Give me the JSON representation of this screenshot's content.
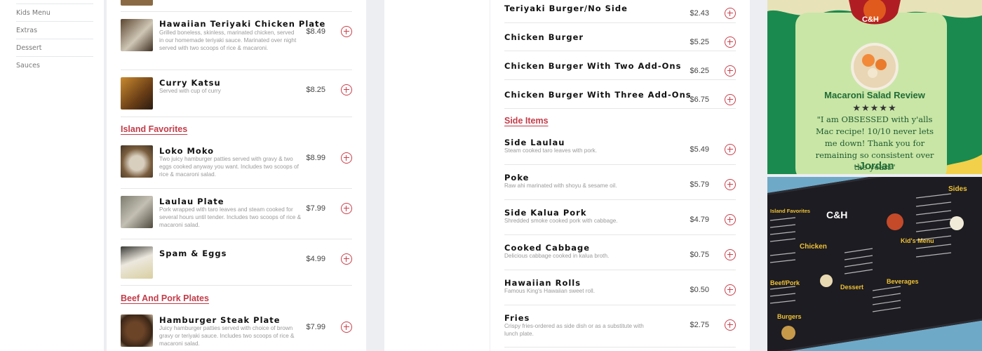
{
  "sidebar": {
    "items": [
      {
        "label": "Kids Menu"
      },
      {
        "label": "Extras"
      },
      {
        "label": "Dessert"
      },
      {
        "label": "Sauces"
      }
    ]
  },
  "left_column": {
    "sections": {
      "island_favorites": "Island Favorites",
      "beef_and_pork": "Beef And Pork Plates"
    },
    "items": [
      {
        "name": "Hawaiian Teriyaki Chicken Plate",
        "desc": "Grilled boneless, skinless, marinated chicken, served in our homemade teriyaki sauce. Marinated over night served with two scoops of rice & macaroni.",
        "price": "$8.49"
      },
      {
        "name": "Curry Katsu",
        "desc": "Served with cup of curry",
        "price": "$8.25"
      },
      {
        "name": "Loko Moko",
        "desc": "Two juicy hamburger patties served with gravy & two eggs cooked anyway you want. Includes two scoops of rice & macaroni salad.",
        "price": "$8.99"
      },
      {
        "name": "Laulau Plate",
        "desc": "Pork wrapped with taro leaves and steam cooked for several hours until tender. Includes two scoops of rice & macaroni salad.",
        "price": "$7.99"
      },
      {
        "name": "Spam & Eggs",
        "desc": "",
        "price": "$4.99"
      },
      {
        "name": "Hamburger Steak Plate",
        "desc": "Juicy hamburger patties served with choice of brown gravy or teriyaki sauce. Includes two scoops of rice & macaroni salad.",
        "price": "$7.99"
      }
    ]
  },
  "right_column": {
    "burgers": [
      {
        "name": "Teriyaki Burger/No Side",
        "price": "$2.43"
      },
      {
        "name": "Chicken Burger",
        "price": "$5.25"
      },
      {
        "name": "Chicken Burger With Two Add-Ons",
        "price": "$6.25"
      },
      {
        "name": "Chicken Burger With Three Add-Ons",
        "price": "$6.75"
      }
    ],
    "side_section": "Side Items",
    "sides": [
      {
        "name": "Side Laulau",
        "desc": "Steam cooked taro leaves with pork.",
        "price": "$5.49"
      },
      {
        "name": "Poke",
        "desc": "Raw ahi marinated with shoyu & sesame oil.",
        "price": "$5.79"
      },
      {
        "name": "Side Kalua Pork",
        "desc": "Shredded smoke cooked pork with cabbage.",
        "price": "$4.79"
      },
      {
        "name": "Cooked Cabbage",
        "desc": "Delicious cabbage cooked in kalua broth.",
        "price": "$0.75"
      },
      {
        "name": "Hawaiian Rolls",
        "desc": "Famous King's Hawaiian sweet roll.",
        "price": "$0.50"
      },
      {
        "name": "Fries",
        "desc": "Crispy fries-ordered as side dish or as a substitute with lunch plate.",
        "price": "$2.75"
      }
    ]
  },
  "promo": {
    "title": "Macaroni Salad Review",
    "stars": "★★★★★",
    "quote": "\"I am OBSESSED with y'alls Mac recipe! 10/10 never lets me down! Thank you for remaining so consistent over the years\"",
    "signature": "-Jordan",
    "logo_text": "C&H"
  },
  "menu_board": {
    "headings": [
      "Island Favorites",
      "Chicken",
      "C&H",
      "Sides",
      "Kid's Menu",
      "Beef/Pork",
      "Dessert",
      "Beverages",
      "Burgers"
    ]
  },
  "colors": {
    "accent": "#c9404a",
    "promo_bg": "#1a8a4e",
    "promo_card": "#c9e6a6"
  }
}
